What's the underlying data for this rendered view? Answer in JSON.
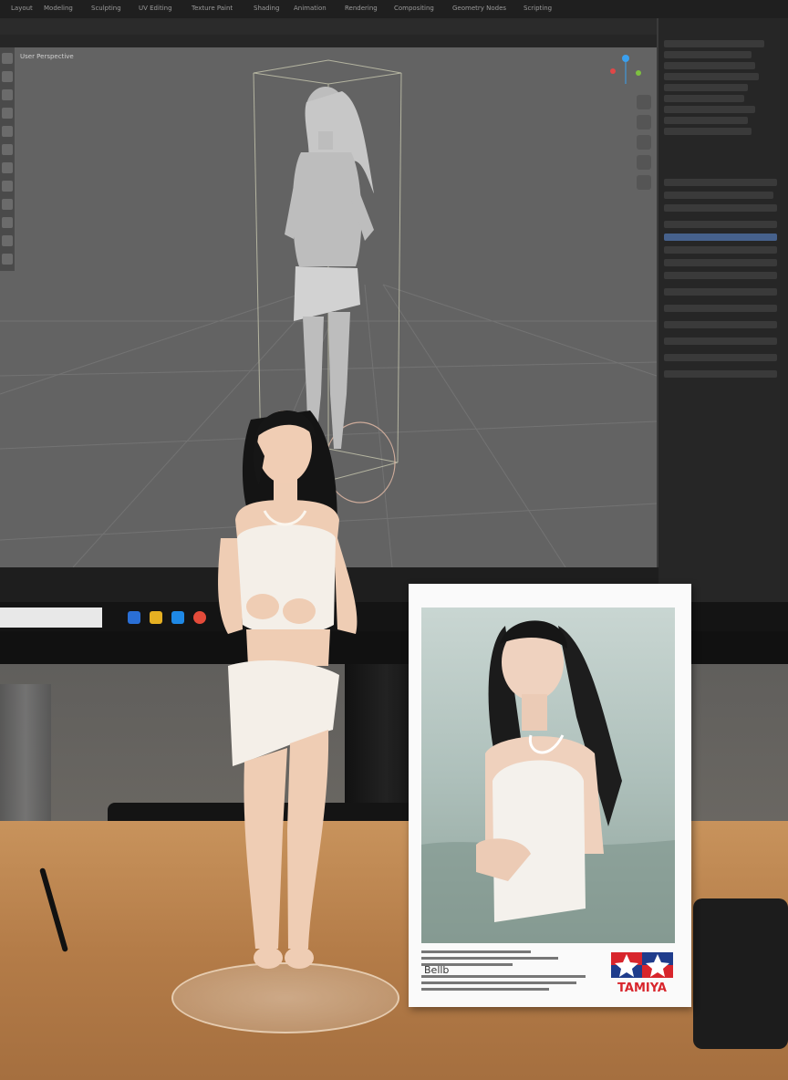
{
  "scene": {
    "description_tags": [
      "monitor",
      "3d-modeling-software",
      "resin-figure",
      "kit-box",
      "desk"
    ]
  },
  "screen": {
    "menu_items": [
      "Layout",
      "Modeling",
      "Sculpting",
      "UV Editing",
      "Texture Paint",
      "Shading",
      "Animation",
      "Rendering",
      "Compositing",
      "Geometry Nodes",
      "Scripting"
    ],
    "viewport_label": "User Perspective"
  },
  "box": {
    "brand": "TAMIYA",
    "brand_mark_text": "Bellb",
    "colors": {
      "red": "#d8252c",
      "blue": "#1f3c8c",
      "white": "#ffffff"
    }
  },
  "colors": {
    "desk": "#b47c48",
    "viewport": "#636363",
    "figure_skin": "#f0cdb4",
    "figure_cloth": "#f4efe8"
  }
}
